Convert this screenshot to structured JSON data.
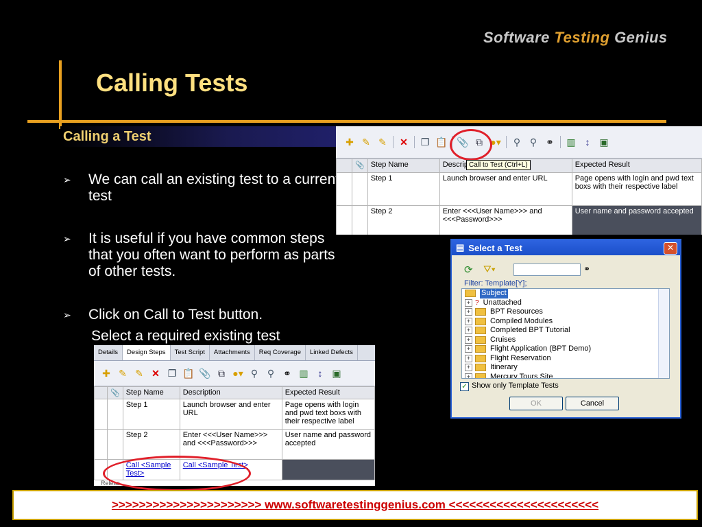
{
  "brand": {
    "part1": "Software ",
    "part2": "Testing",
    "part3": " Genius"
  },
  "slide": {
    "title": "Calling Tests",
    "subtitle": "Calling a Test",
    "bullets": [
      "We can call an existing test to a current test",
      "It is useful if you have common steps that you often want to perform as parts of other tests.",
      "Click on Call to Test button."
    ],
    "extra_line": "Select a required existing test"
  },
  "grid1": {
    "headers": [
      "Step Name",
      "Descripti",
      "Expected Result"
    ],
    "rows": [
      {
        "step": "Step 1",
        "desc": "Launch browser and enter URL",
        "exp": "Page opens with login and pwd text boxs with their respective label"
      },
      {
        "step": "Step 2",
        "desc": "Enter  <<<User Name>>>  and <<<Password>>>",
        "exp": "User name and password accepted"
      }
    ],
    "tooltip": "Call to Test (Ctrl+L)"
  },
  "dialog": {
    "title": "Select a Test",
    "filter": "Filter: Template[Y];",
    "items": [
      "Subject",
      "Unattached",
      "BPT Resources",
      "Compiled Modules",
      "Completed BPT Tutorial",
      "Cruises",
      "Flight Application (BPT Demo)",
      "Flight Reservation",
      "Itinerary",
      "Mercury Tours Site"
    ],
    "checkbox": "Show only Template Tests",
    "ok": "OK",
    "cancel": "Cancel"
  },
  "grid2": {
    "tabs": [
      "Details",
      "Design Steps",
      "Test Script",
      "Attachments",
      "Req Coverage",
      "Linked Defects"
    ],
    "headers": [
      "Step Name",
      "Description",
      "Expected Result"
    ],
    "rows": [
      {
        "step": "Step 1",
        "desc": "Launch browser and enter URL",
        "exp": "Page opens with login and pwd text boxs with their respective label"
      },
      {
        "step": "Step 2",
        "desc": "Enter  <<<User Name>>>  and <<<Password>>>",
        "exp": "User name and password accepted"
      },
      {
        "step": "Call <Sample Test>",
        "desc": "Call <Sample Test>",
        "exp": ""
      }
    ],
    "bottom_tab": "Releas"
  },
  "footer": ">>>>>>>>>>>>>>>>>>>>>>  www.softwaretestinggenius.com  <<<<<<<<<<<<<<<<<<<<<<"
}
